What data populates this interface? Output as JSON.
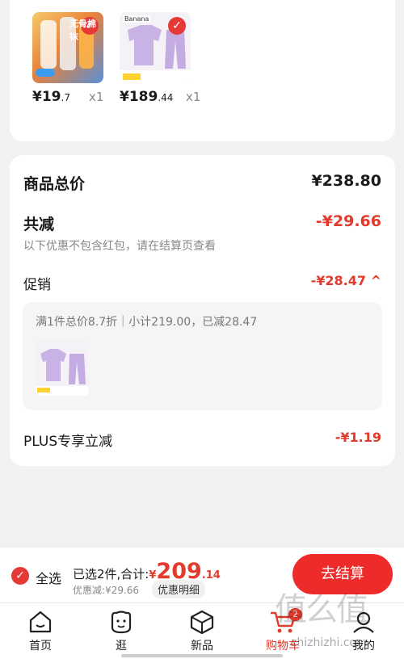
{
  "items": [
    {
      "price_int": "¥19",
      "price_dec": ".7",
      "qty": "x1",
      "thumb_text": "无骨棉袜"
    },
    {
      "price_int": "¥189",
      "price_dec": ".44",
      "qty": "x1",
      "thumb_text": "Banana"
    }
  ],
  "summary": {
    "total_label": "商品总价",
    "total_value": "¥238.80",
    "reduce_label": "共减",
    "reduce_value": "-¥29.66",
    "reduce_note": "以下优惠不包含红包，请在结算页查看",
    "promo_label": "促销",
    "promo_value": "-¥28.47 ^",
    "promo_detail": "满1件总价8.7折｜小计219.00，已减28.47",
    "plus_label": "PLUS专享立减",
    "plus_value": "-¥1.19"
  },
  "bottom": {
    "select_all": "全选",
    "selected": "已选2件,合计:",
    "currency": "¥",
    "total_int": "209",
    "total_dec": ".14",
    "discount": "优惠减:¥29.66",
    "detail_btn": "优惠明细",
    "checkout": "去结算"
  },
  "tabs": [
    {
      "label": "首页",
      "icon": "home-icon"
    },
    {
      "label": "逛",
      "icon": "face-icon"
    },
    {
      "label": "新品",
      "icon": "cube-icon"
    },
    {
      "label": "购物车",
      "icon": "cart-icon",
      "badge": "2"
    },
    {
      "label": "我的",
      "icon": "user-icon"
    }
  ],
  "watermark": {
    "text": "值么值",
    "url": "zhizhizhi.com"
  },
  "colors": {
    "accent": "#e23b2e",
    "checkout_bg": "#ee2b2b"
  }
}
